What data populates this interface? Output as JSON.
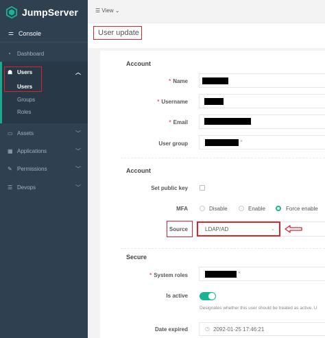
{
  "sidebar": {
    "brand": "JumpServer",
    "console": "Console",
    "items": [
      {
        "label": "Dashboard",
        "icon": "dashboard-icon"
      },
      {
        "label": "Users",
        "icon": "users-icon"
      },
      {
        "label": "Assets",
        "icon": "assets-icon"
      },
      {
        "label": "Applications",
        "icon": "applications-icon"
      },
      {
        "label": "Permissions",
        "icon": "permissions-icon"
      },
      {
        "label": "Devops",
        "icon": "devops-icon"
      }
    ],
    "users_sub": [
      "Users",
      "Groups",
      "Roles"
    ]
  },
  "topbar": {
    "view_label": "View"
  },
  "page": {
    "title": "User update"
  },
  "form": {
    "section_account": "Account",
    "name_label": "Name",
    "username_label": "Username",
    "email_label": "Email",
    "user_group_label": "User group",
    "section_account2": "Account",
    "set_public_key_label": "Set public key",
    "mfa_label": "MFA",
    "mfa_options": [
      "Disable",
      "Enable",
      "Force enable"
    ],
    "mfa_selected": "Force enable",
    "source_label": "Source",
    "source_value": "LDAP/AD",
    "section_secure": "Secure",
    "system_roles_label": "System roles",
    "is_active_label": "Is active",
    "is_active_help": "Designates whether this user should be treated as active. U",
    "date_expired_label": "Date expired",
    "date_expired_value": "2092-01-25 17:46:21"
  },
  "colors": {
    "sidebar_bg": "#2f4050",
    "accent": "#1ab394",
    "highlight": "#d9232d"
  }
}
